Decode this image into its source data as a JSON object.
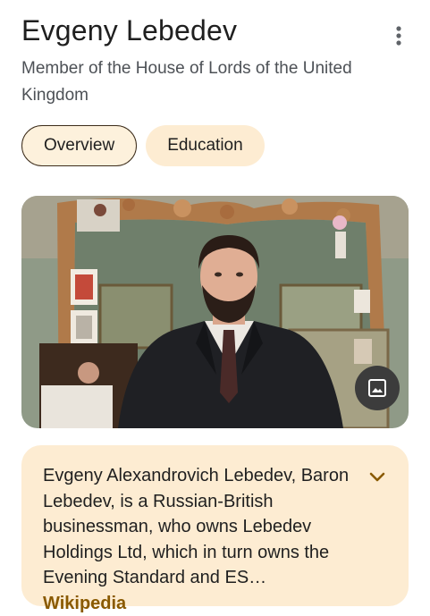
{
  "header": {
    "title": "Evgeny Lebedev",
    "subtitle": "Member of the House of Lords of the United Kingdom",
    "more_icon": "more-vert-icon"
  },
  "tabs": [
    {
      "label": "Overview",
      "selected": true
    },
    {
      "label": "Education",
      "selected": false
    }
  ],
  "photo": {
    "image_button_icon": "image-icon"
  },
  "description": {
    "text": "Evgeny Alexandrovich Lebedev, Baron Lebedev, is a Russian-British businessman, who owns Lebedev Holdings Ltd, which in turn owns the Evening Standard and ES… ",
    "source_label": "Wikipedia",
    "expand_icon": "chevron-down-icon"
  },
  "colors": {
    "tab_active_bg": "#fdf1dc",
    "tab_inactive_bg": "#fdecd2",
    "card_bg": "#fdecd2",
    "link_color": "#8a5a00"
  }
}
